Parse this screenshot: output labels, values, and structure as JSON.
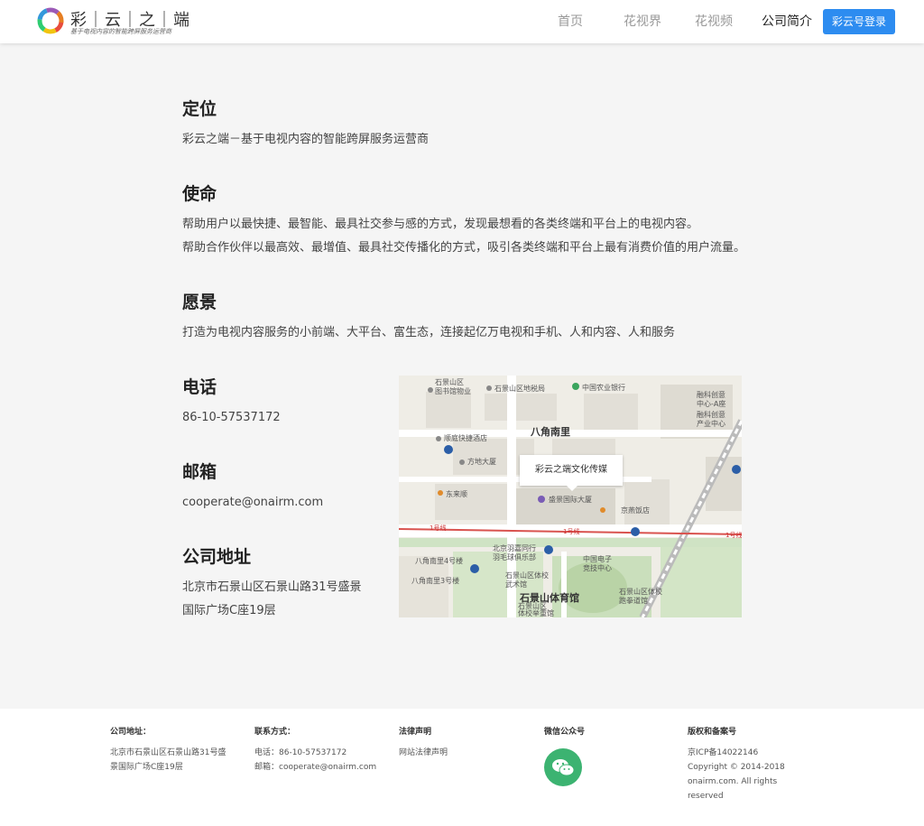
{
  "header": {
    "logo_title": "彩｜云｜之｜端",
    "logo_subtitle": "基于电视内容的智能跨屏服务运营商",
    "nav": [
      "首页",
      "花视界",
      "花视频",
      "公司简介"
    ],
    "login_label": "彩云号登录"
  },
  "sections": {
    "position_title": "定位",
    "position_text": "彩云之端－基于电视内容的智能跨屏服务运营商",
    "mission_title": "使命",
    "mission_line1": "帮助用户以最快捷、最智能、最具社交参与感的方式，发现最想看的各类终端和平台上的电视内容。",
    "mission_line2": "帮助合作伙伴以最高效、最增值、最具社交传播化的方式，吸引各类终端和平台上最有消费价值的用户流量。",
    "vision_title": "愿景",
    "vision_text": "打造为电视内容服务的小前端、大平台、富生态，连接起亿万电视和手机、人和内容、人和服务",
    "phone_title": "电话",
    "phone_value": "86-10-57537172",
    "email_title": "邮箱",
    "email_value": "cooperate@onairm.com",
    "address_title": "公司地址",
    "address_line1": "北京市石景山区石景山路31号盛景",
    "address_line2": "国际广场C座19层"
  },
  "map": {
    "popup": "彩云之端文化传媒",
    "labels": {
      "l1": "石景山区",
      "l2": "图书馆物业",
      "l3": "石景山区地税局",
      "l4": "中国农业银行",
      "l5": "融科创意",
      "l6": "中心-A座",
      "l7": "融科创意",
      "l8": "产业中心",
      "l9": "八角南里",
      "l10": "顺庭快捷酒店",
      "l11": "方地大厦",
      "l12": "东来顺",
      "l13": "盛景国际大厦",
      "l14": "京燕饭店",
      "l15": "1号线",
      "l16": "1号线",
      "l17": "1号线",
      "l18": "北京羽嘉同行",
      "l19": "羽毛球俱乐部",
      "l20": "中国电子",
      "l21": "竞技中心",
      "l22": "石景山区体校",
      "l23": "武术馆",
      "l24": "石景山体育馆",
      "l25": "石景山区体校",
      "l26": "跑拳道馆",
      "l27": "八角南里4号楼",
      "l28": "八角南里3号楼",
      "l29": "石景山区",
      "l30": "体校举重馆"
    }
  },
  "footer": {
    "col1_head": "公司地址：",
    "col1_line1": "北京市石景山区石景山路31号盛",
    "col1_line2": "景国际广场C座19层",
    "col2_head": "联系方式：",
    "col2_line1": "电话：86-10-57537172",
    "col2_line2": "邮箱：cooperate@onairm.com",
    "col3_head": "法律声明",
    "col3_line1": "网站法律声明",
    "col4_head": "微信公众号",
    "col5_head": "版权和备案号",
    "col5_line1": "京ICP备14022146",
    "col5_line2": "Copyright © 2014-2018",
    "col5_line3": "onairm.com.  All rights",
    "col5_line4": "reserved"
  },
  "colors": {
    "accent": "#2d8cf0",
    "wechat": "#3cb371",
    "background": "#f5f5f5"
  },
  "icons": [
    "logo-ring-icon",
    "wechat-icon",
    "map-marker-icon",
    "metro-icon"
  ]
}
